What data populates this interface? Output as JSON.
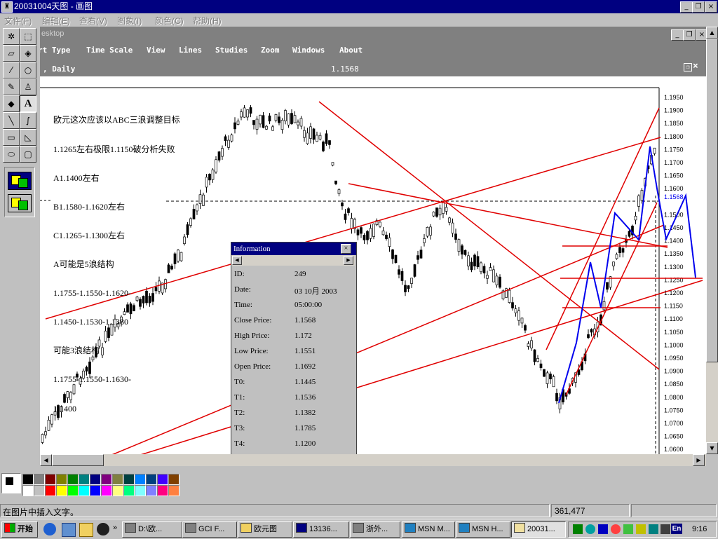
{
  "window": {
    "title": "20031004天图 - 画图",
    "controls": [
      "_",
      "❐",
      "×"
    ]
  },
  "menu": [
    "文件(F)",
    "编辑(E)",
    "查看(V)",
    "图象(I)",
    "颜色(C)",
    "帮助(H)"
  ],
  "tools": [
    {
      "name": "free-select",
      "glyph": "✲"
    },
    {
      "name": "rect-select",
      "glyph": "⬚"
    },
    {
      "name": "eraser",
      "glyph": "▱"
    },
    {
      "name": "fill",
      "glyph": "◈"
    },
    {
      "name": "pick-color",
      "glyph": "⁄"
    },
    {
      "name": "magnifier",
      "glyph": "○"
    },
    {
      "name": "pencil",
      "glyph": "✎"
    },
    {
      "name": "brush",
      "glyph": "♙"
    },
    {
      "name": "airbrush",
      "glyph": "◆"
    },
    {
      "name": "text",
      "glyph": "A"
    },
    {
      "name": "line",
      "glyph": "╲"
    },
    {
      "name": "curve",
      "glyph": "∫"
    },
    {
      "name": "rectangle",
      "glyph": "▭"
    },
    {
      "name": "polygon",
      "glyph": "◺"
    },
    {
      "name": "ellipse",
      "glyph": "⬭"
    },
    {
      "name": "rounded-rect",
      "glyph": "▢"
    }
  ],
  "captured": {
    "inner_title": "esktop",
    "inner_menu": [
      "rt Type",
      "Time Scale",
      "View",
      "Lines",
      "Studies",
      "Zoom",
      "Windows",
      "About"
    ],
    "header_left": ", Daily",
    "header_price": "1.1568",
    "price_axis": [
      "1.1950",
      "1.1900",
      "1.1850",
      "1.1800",
      "1.1750",
      "1.1700",
      "1.1650",
      "1.1600",
      "1.1568",
      "1.1500",
      "1.1450",
      "1.1400",
      "1.1350",
      "1.1300",
      "1.1250",
      "1.1200",
      "1.1150",
      "1.1100",
      "1.1050",
      "1.1000",
      "1.0950",
      "1.0900",
      "1.0850",
      "1.0800",
      "1.0750",
      "1.0700",
      "1.0650",
      "1.0600"
    ],
    "annotations": [
      "欧元这次应该以ABC三浪调整目标",
      "1.1265左右极限1.1150破分析失败",
      "A1.1400左右",
      "B1.1580-1.1620左右",
      "C1.1265-1.1300左右",
      "A可能是5浪结构",
      "1.1755-1.1550-1.1620-",
      "1.1450-1.1530-1.1380",
      "可能3浪结构",
      "1.1755-1.1550-1.1630-",
      "1.1400"
    ],
    "info": {
      "title": "Information",
      "fields": [
        {
          "label": "ID:",
          "value": "249"
        },
        {
          "label": "Date:",
          "value": "03 10月 2003"
        },
        {
          "label": "Time:",
          "value": "05:00:00"
        },
        {
          "label": "Close Price:",
          "value": "1.1568"
        },
        {
          "label": "High Price:",
          "value": "1.172"
        },
        {
          "label": "Low Price:",
          "value": "1.1551"
        },
        {
          "label": "Open Price:",
          "value": "1.1692"
        },
        {
          "label": "T0:",
          "value": "1.1445"
        },
        {
          "label": "T1:",
          "value": "1.1536"
        },
        {
          "label": "T2:",
          "value": "1.1382"
        },
        {
          "label": "T3:",
          "value": "1.1785"
        },
        {
          "label": "T4:",
          "value": "1.1200"
        }
      ]
    }
  },
  "colors": {
    "trendline": "#e00000",
    "wave": "#0000ee",
    "candle": "#000000",
    "palette": [
      "#000000",
      "#808080",
      "#800000",
      "#808000",
      "#008000",
      "#008080",
      "#000080",
      "#800080",
      "#808040",
      "#004040",
      "#0080ff",
      "#004080",
      "#4000ff",
      "#804000",
      "#ffffff",
      "#c0c0c0",
      "#ff0000",
      "#ffff00",
      "#00ff00",
      "#00ffff",
      "#0000ff",
      "#ff00ff",
      "#ffff80",
      "#00ff80",
      "#80ffff",
      "#8080ff",
      "#ff0080",
      "#ff8040"
    ]
  },
  "status": {
    "message": "在图片中插入文字。",
    "coords": "361,477"
  },
  "taskbar": {
    "start": "开始",
    "tasks": [
      "D:\\欧...",
      "GCI F...",
      "欧元图",
      "13136...",
      "浙外...",
      "MSN M...",
      "MSN H...",
      "20031..."
    ],
    "active_task": 7,
    "clock": "9:16",
    "tray_lang": "En"
  }
}
